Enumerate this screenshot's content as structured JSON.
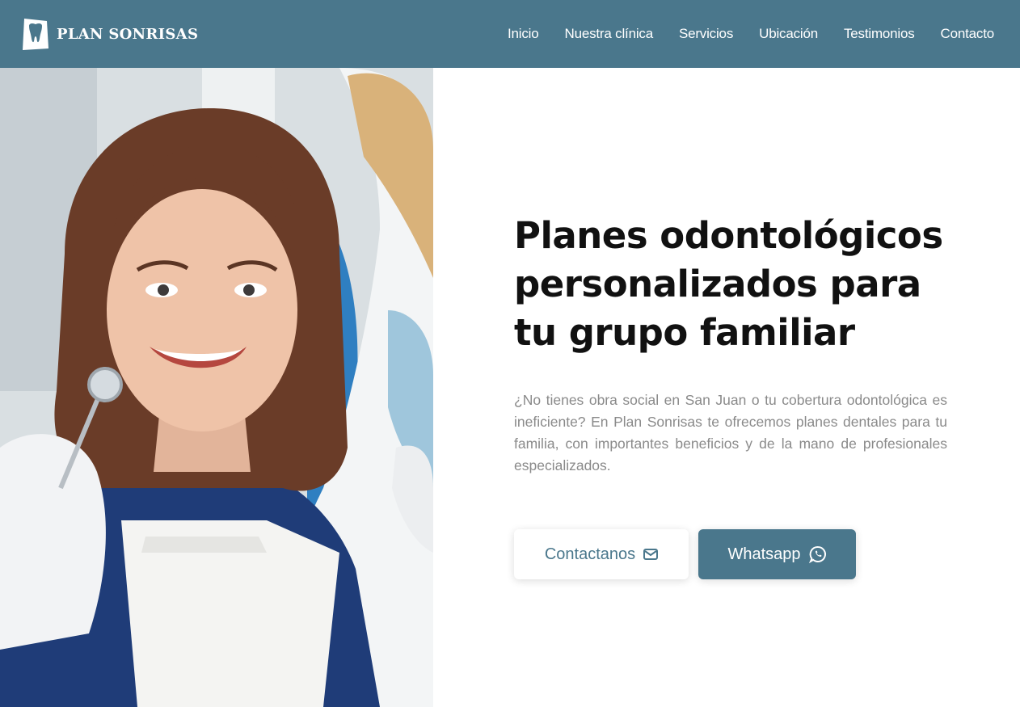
{
  "brand": {
    "name": "PLAN SONRISAS",
    "logo_icon": "tooth-icon"
  },
  "nav": {
    "items": [
      {
        "label": "Inicio"
      },
      {
        "label": "Nuestra clínica"
      },
      {
        "label": "Servicios"
      },
      {
        "label": "Ubicación"
      },
      {
        "label": "Testimonios"
      },
      {
        "label": "Contacto"
      }
    ]
  },
  "hero": {
    "title": "Planes odontológicos personalizados para tu grupo familiar",
    "description": "¿No tienes obra social en San Juan o tu cobertura odontológica es ineficiente? En Plan Sonrisas te ofrecemos planes dentales para tu familia, con importantes beneficios y de la mano de profesionales especializados.",
    "image_icon": "smiling-patient-photo",
    "buttons": {
      "contact_label": "Contactanos",
      "contact_icon": "envelope-icon",
      "whatsapp_label": "Whatsapp",
      "whatsapp_icon": "whatsapp-icon"
    }
  },
  "colors": {
    "primary": "#4a778c",
    "title": "#111111",
    "text_muted": "#8a8a8a",
    "background": "#ffffff"
  }
}
